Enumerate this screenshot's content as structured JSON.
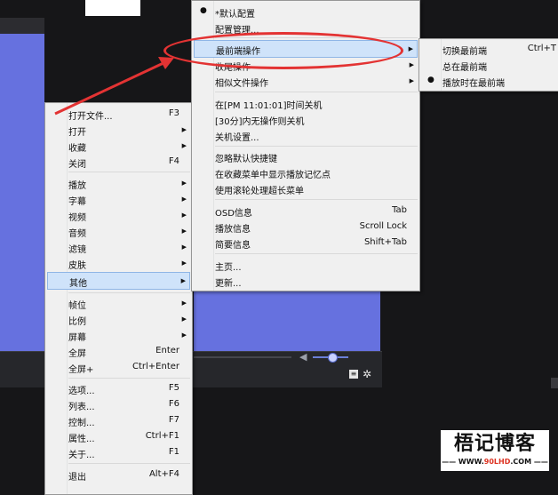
{
  "main_menu": {
    "items": [
      {
        "label": "打开文件...",
        "shortcut": "F3"
      },
      {
        "label": "打开",
        "shortcut": ""
      },
      {
        "label": "收藏",
        "shortcut": ""
      },
      {
        "label": "关闭",
        "shortcut": "F4"
      },
      {
        "label": "播放",
        "shortcut": ""
      },
      {
        "label": "字幕",
        "shortcut": ""
      },
      {
        "label": "视频",
        "shortcut": ""
      },
      {
        "label": "音频",
        "shortcut": ""
      },
      {
        "label": "滤镜",
        "shortcut": ""
      },
      {
        "label": "皮肤",
        "shortcut": ""
      },
      {
        "label": "其他",
        "shortcut": ""
      },
      {
        "label": "帧位",
        "shortcut": ""
      },
      {
        "label": "比例",
        "shortcut": ""
      },
      {
        "label": "屏幕",
        "shortcut": ""
      },
      {
        "label": "全屏",
        "shortcut": "Enter"
      },
      {
        "label": "全屏+",
        "shortcut": "Ctrl+Enter"
      },
      {
        "label": "选项...",
        "shortcut": "F5"
      },
      {
        "label": "列表...",
        "shortcut": "F6"
      },
      {
        "label": "控制...",
        "shortcut": "F7"
      },
      {
        "label": "属性...",
        "shortcut": "Ctrl+F1"
      },
      {
        "label": "关于...",
        "shortcut": "F1"
      },
      {
        "label": "退出",
        "shortcut": "Alt+F4"
      }
    ]
  },
  "other_menu": {
    "items": [
      {
        "label": "*默认配置",
        "shortcut": ""
      },
      {
        "label": "配置管理...",
        "shortcut": ""
      },
      {
        "label": "最前端操作",
        "shortcut": ""
      },
      {
        "label": "收尾操作",
        "shortcut": ""
      },
      {
        "label": "相似文件操作",
        "shortcut": ""
      },
      {
        "label": "在[PM 11:01:01]时间关机",
        "shortcut": ""
      },
      {
        "label": "[30分]内无操作则关机",
        "shortcut": ""
      },
      {
        "label": "关机设置...",
        "shortcut": ""
      },
      {
        "label": "忽略默认快捷键",
        "shortcut": ""
      },
      {
        "label": "在收藏菜单中显示播放记忆点",
        "shortcut": ""
      },
      {
        "label": "使用滚轮处理超长菜单",
        "shortcut": ""
      },
      {
        "label": "OSD信息",
        "shortcut": "Tab"
      },
      {
        "label": "播放信息",
        "shortcut": "Scroll Lock"
      },
      {
        "label": "简要信息",
        "shortcut": "Shift+Tab"
      },
      {
        "label": "主页...",
        "shortcut": ""
      },
      {
        "label": "更新...",
        "shortcut": ""
      }
    ]
  },
  "topmost_menu": {
    "items": [
      {
        "label": "切换最前端",
        "shortcut": "Ctrl+T"
      },
      {
        "label": "总在最前端",
        "shortcut": ""
      },
      {
        "label": "播放时在最前端",
        "shortcut": ""
      }
    ]
  },
  "watermark": {
    "title": "梧记博客",
    "url_prefix": "—— WWW.",
    "url_highlight": "90LHD",
    "url_suffix": ".COM ——"
  },
  "colors": {
    "video_blue": "#6671df",
    "menu_bg": "#f0f0f0",
    "highlight": "#cfe3fa",
    "annotation_red": "#e33333"
  }
}
